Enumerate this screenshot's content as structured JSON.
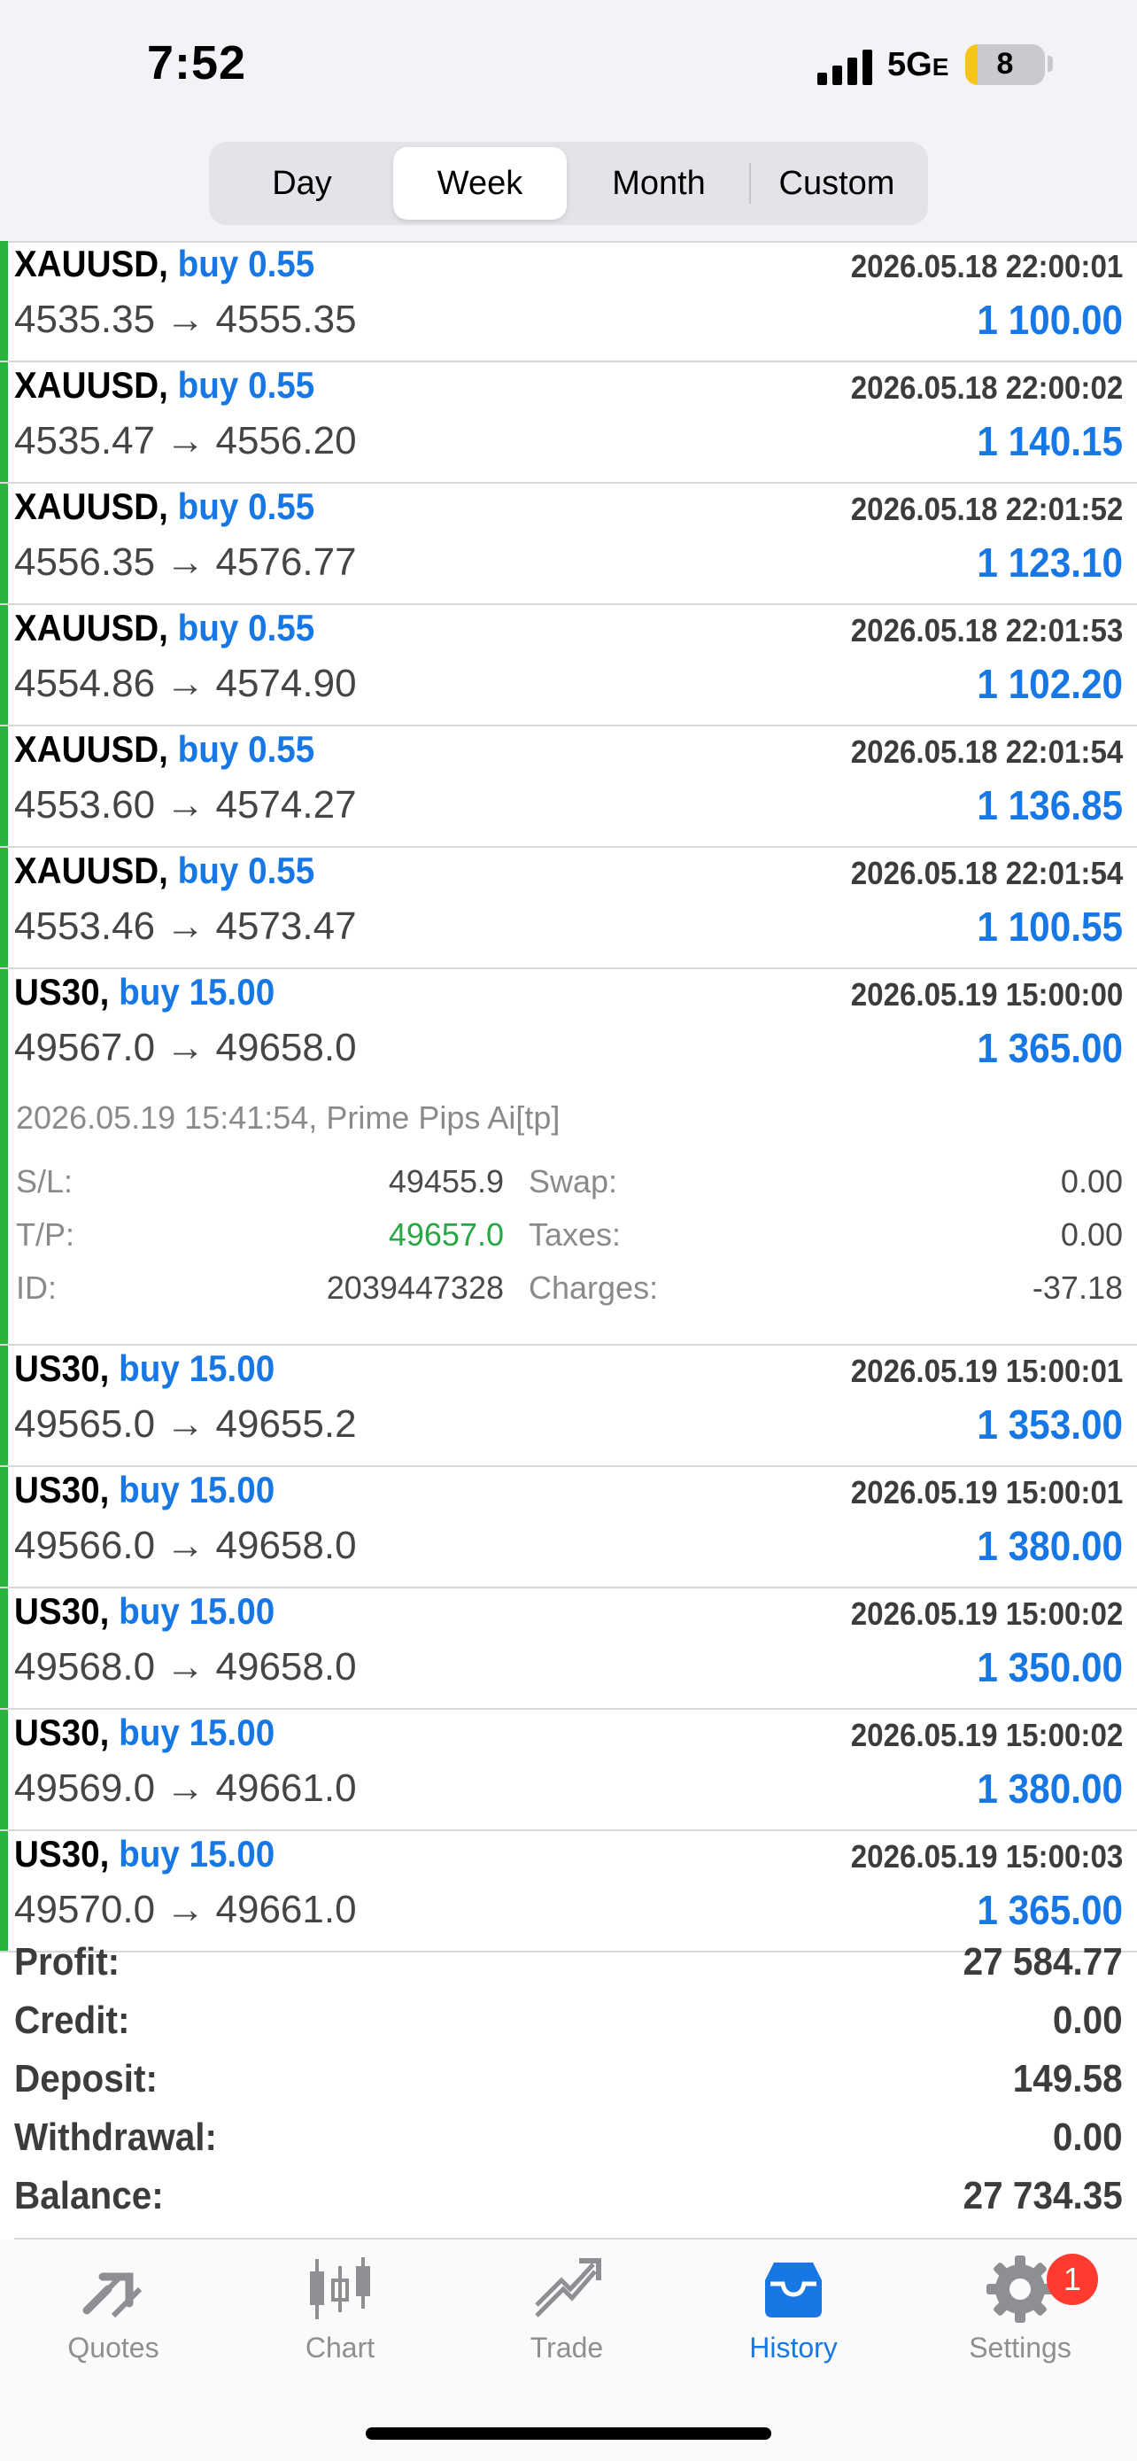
{
  "status_bar": {
    "time": "7:52",
    "network": "5G",
    "network_suffix": "E",
    "battery": "8"
  },
  "segments": [
    "Day",
    "Week",
    "Month",
    "Custom"
  ],
  "selected_segment": "Week",
  "trades": [
    {
      "symbol": "XAUUSD,",
      "type": "buy 0.55",
      "prices": "4535.35 → 4555.35",
      "time": "2026.05.18 22:00:01",
      "profit": "1 100.00"
    },
    {
      "symbol": "XAUUSD,",
      "type": "buy 0.55",
      "prices": "4535.47 → 4556.20",
      "time": "2026.05.18 22:00:02",
      "profit": "1 140.15"
    },
    {
      "symbol": "XAUUSD,",
      "type": "buy 0.55",
      "prices": "4556.35 → 4576.77",
      "time": "2026.05.18 22:01:52",
      "profit": "1 123.10"
    },
    {
      "symbol": "XAUUSD,",
      "type": "buy 0.55",
      "prices": "4554.86 → 4574.90",
      "time": "2026.05.18 22:01:53",
      "profit": "1 102.20"
    },
    {
      "symbol": "XAUUSD,",
      "type": "buy 0.55",
      "prices": "4553.60 → 4574.27",
      "time": "2026.05.18 22:01:54",
      "profit": "1 136.85"
    },
    {
      "symbol": "XAUUSD,",
      "type": "buy 0.55",
      "prices": "4553.46 → 4573.47",
      "time": "2026.05.18 22:01:54",
      "profit": "1 100.55"
    },
    {
      "symbol": "US30,",
      "type": "buy 15.00",
      "prices": "49567.0 → 49658.0",
      "time": "2026.05.19 15:00:00",
      "profit": "1 365.00"
    },
    {
      "symbol": "US30,",
      "type": "buy 15.00",
      "prices": "49565.0 → 49655.2",
      "time": "2026.05.19 15:00:01",
      "profit": "1 353.00"
    },
    {
      "symbol": "US30,",
      "type": "buy 15.00",
      "prices": "49566.0 → 49658.0",
      "time": "2026.05.19 15:00:01",
      "profit": "1 380.00"
    },
    {
      "symbol": "US30,",
      "type": "buy 15.00",
      "prices": "49568.0 → 49658.0",
      "time": "2026.05.19 15:00:02",
      "profit": "1 350.00"
    },
    {
      "symbol": "US30,",
      "type": "buy 15.00",
      "prices": "49569.0 → 49661.0",
      "time": "2026.05.19 15:00:02",
      "profit": "1 380.00"
    },
    {
      "symbol": "US30,",
      "type": "buy 15.00",
      "prices": "49570.0 → 49661.0",
      "time": "2026.05.19 15:00:03",
      "profit": "1 365.00"
    }
  ],
  "expanded": {
    "header": "2026.05.19 15:41:54, Prime Pips Ai[tp]",
    "sl_label": "S/L:",
    "sl": "49455.9",
    "tp_label": "T/P:",
    "tp": "49657.0",
    "id_label": "ID:",
    "id": "2039447328",
    "swap_label": "Swap:",
    "swap": "0.00",
    "taxes_label": "Taxes:",
    "taxes": "0.00",
    "charges_label": "Charges:",
    "charges": "-37.18"
  },
  "summary": [
    {
      "label": "Profit:",
      "value": "27 584.77"
    },
    {
      "label": "Credit:",
      "value": "0.00"
    },
    {
      "label": "Deposit:",
      "value": "149.58"
    },
    {
      "label": "Withdrawal:",
      "value": "0.00"
    },
    {
      "label": "Balance:",
      "value": "27 734.35"
    }
  ],
  "tabs": [
    {
      "label": "Quotes",
      "icon": "quotes-icon"
    },
    {
      "label": "Chart",
      "icon": "chart-icon"
    },
    {
      "label": "Trade",
      "icon": "trade-icon"
    },
    {
      "label": "History",
      "icon": "history-icon"
    },
    {
      "label": "Settings",
      "icon": "settings-icon"
    }
  ],
  "active_tab": "History",
  "settings_badge": "1",
  "colors": {
    "accent": "#1677e5",
    "buy_bar": "#28b43c",
    "tp_green": "#28a745",
    "badge": "#ff3b30"
  }
}
